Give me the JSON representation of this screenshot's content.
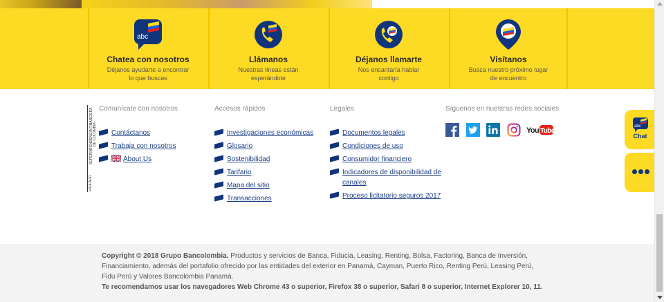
{
  "contact": {
    "items": [
      {
        "icon": "chat-abc-icon",
        "title": "Chatea con nosotros",
        "subtitle": "Déjanos ayudarte a encontrar lo que buscas"
      },
      {
        "icon": "phone-icon",
        "title": "Llámanos",
        "subtitle": "Nuestras líneas están esperándote"
      },
      {
        "icon": "callback-phone-icon",
        "title": "Déjanos llamarte",
        "subtitle": "Nos encantaría hablar contigo"
      },
      {
        "icon": "map-pin-icon",
        "title": "Visítanos",
        "subtitle": "Busca nuestro próximo lugar de encuentro"
      }
    ]
  },
  "vigilado": {
    "line1": "VIGILADO",
    "line2": "SUPERINTENDENCIA FINANCIERA",
    "line3": "DE COLOMBIA"
  },
  "footer": {
    "columns": [
      {
        "heading": "Comunícate con nosotros",
        "links": [
          "Contáctanos",
          "Trabaja con nosotros",
          "About Us"
        ]
      },
      {
        "heading": "Accesos rápidos",
        "links": [
          "Investigaciones económicas",
          "Glosario",
          "Sostenibilidad",
          "Tarifario",
          "Mapa del sitio",
          "Transacciones"
        ]
      },
      {
        "heading": "Legales",
        "links": [
          "Documentos legales",
          "Condiciones de uso",
          "Consumidor financiero",
          "Indicadores de disponibilidad de canales",
          "Proceso licitatorio seguros 2017"
        ]
      }
    ],
    "social": {
      "heading": "Síguenos en nuestras redes sociales",
      "networks": [
        "facebook-icon",
        "twitter-icon",
        "linkedin-icon",
        "instagram-icon",
        "youtube-icon"
      ],
      "youtube_text": "YouTube"
    }
  },
  "legal": {
    "copyright_bold": "Copyright © 2018 Grupo Bancolombia.",
    "copyright_text": " Productos y servicios de Banca, Fiducia, Leasing, Renting, Bolsa, Factoring, Banca de Inversión, Financiamiento, además del portafolio ofrecido por las entidades del exterior en Panamá, Cayman, Puerto Rico, Renting Perú, Leasing Perú, Fidu Perú y Valores Bancolombia Panamá.",
    "browsers": "Te recomendamos usar los navegadores Web Chrome 43 o superior, Firefox 38 o superior, Safari 8 o superior, Internet Explorer 10, 11."
  },
  "fab": {
    "chat_label": "Chat",
    "chat_icon_text": "abc"
  },
  "colors": {
    "brand_yellow": "#fdda24",
    "brand_blue": "#10357c",
    "link_blue": "#1b3f86"
  }
}
